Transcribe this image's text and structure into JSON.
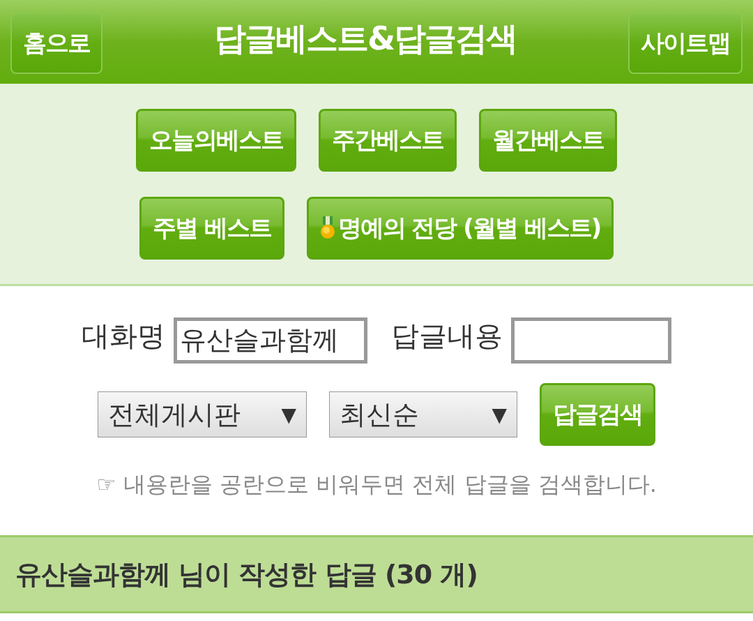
{
  "header": {
    "home_button": "홈으로",
    "title": "답글베스트&답글검색",
    "sitemap_button": "사이트맵"
  },
  "nav_rows": [
    [
      {
        "kind": "plain",
        "label": "오늘의베스트"
      },
      {
        "kind": "plain",
        "label": "주간베스트"
      },
      {
        "kind": "plain",
        "label": "월간베스트"
      }
    ],
    [
      {
        "kind": "plain",
        "label": "주별 베스트"
      },
      {
        "kind": "medal",
        "label": "명예의 전당 (월별 베스트)"
      }
    ]
  ],
  "search": {
    "name_label": "대화명",
    "name_value": "유산슬과함께",
    "content_label": "답글내용",
    "board_select": {
      "value": "전체게시판",
      "caret": "▼"
    },
    "order_select": {
      "value": "최신순",
      "caret": "▼"
    },
    "button": "답글검색",
    "hint": "☞ 내용란을 공란으로 비워두면 전체 답글을 검색합니다."
  },
  "result_heading": "유산슬과함께 님이 작성한 답글 (30 개)"
}
